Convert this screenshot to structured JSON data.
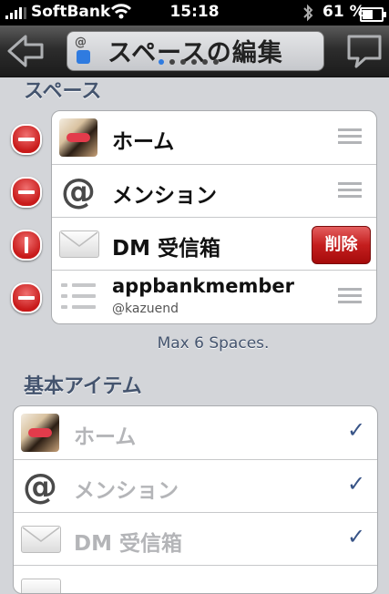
{
  "status_bar": {
    "carrier": "SoftBank",
    "time": "15:18",
    "battery": "61 %",
    "battery_fraction": 0.61
  },
  "nav": {
    "title": "スペースの編集",
    "page_count": 6,
    "current_page": 1
  },
  "spaces_section": {
    "title": "スペース",
    "items": [
      {
        "label": "ホーム",
        "icon": "dog-avatar-icon",
        "state": "normal"
      },
      {
        "label": "メンション",
        "icon": "at-icon",
        "state": "normal"
      },
      {
        "label": "DM 受信箱",
        "icon": "envelope-icon",
        "state": "delete-confirm",
        "delete_label": "削除"
      },
      {
        "label": "appbankmember",
        "sublabel": "@kazuend",
        "icon": "list-icon",
        "state": "normal"
      }
    ],
    "footer": "Max 6 Spaces."
  },
  "basic_section": {
    "title": "基本アイテム",
    "items": [
      {
        "label": "ホーム",
        "icon": "dog-avatar-icon",
        "checked": true
      },
      {
        "label": "メンション",
        "icon": "at-icon",
        "checked": true
      },
      {
        "label": "DM 受信箱",
        "icon": "envelope-icon",
        "checked": true
      }
    ],
    "check_glyph": "✓"
  },
  "colors": {
    "accent": "#2f7be0",
    "delete": "#c41e1e",
    "section_text": "#44546e",
    "check": "#385487"
  }
}
